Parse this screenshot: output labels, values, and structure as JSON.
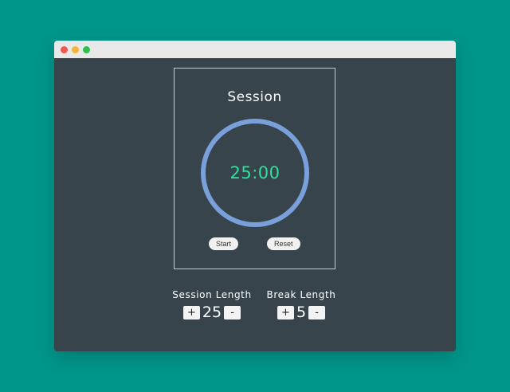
{
  "window": {
    "controls": {
      "close_color": "#ef5a4c",
      "minimize_color": "#f3b43a",
      "maximize_color": "#2bc247"
    }
  },
  "timer": {
    "title": "Session",
    "time": "25:00",
    "ring_color": "#7aa0db",
    "time_color": "#2be29a",
    "start_label": "Start",
    "reset_label": "Reset"
  },
  "session_length": {
    "label": "Session Length",
    "value": "25",
    "increment_label": "+",
    "decrement_label": "-"
  },
  "break_length": {
    "label": "Break Length",
    "value": "5",
    "increment_label": "+",
    "decrement_label": "-"
  }
}
